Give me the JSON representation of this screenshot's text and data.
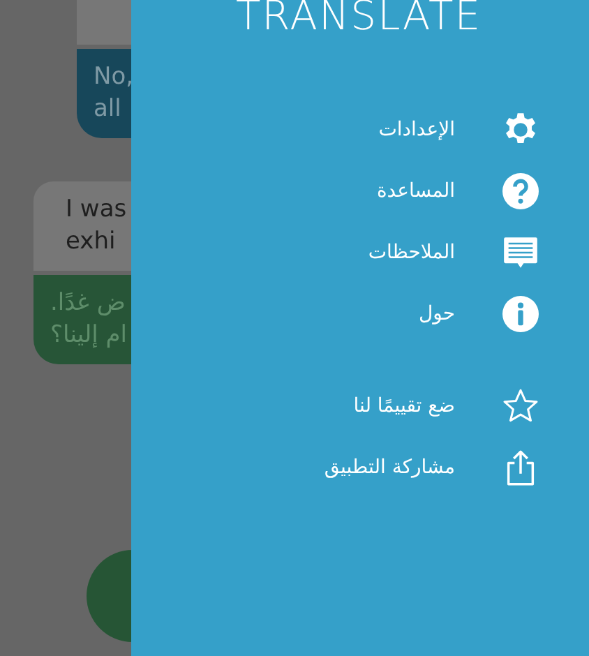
{
  "chat": {
    "messages": [
      {
        "kind": "original",
        "color": "#777777"
      },
      {
        "kind": "translation",
        "color": "#17475a",
        "lines": [
          "No,",
          "all"
        ]
      },
      {
        "kind": "original",
        "color": "#777777",
        "lines": [
          "I was",
          "exhi"
        ]
      },
      {
        "kind": "translation",
        "color": "#275537",
        "lines": [
          "ض غدًا.",
          "ام إلينا؟"
        ]
      }
    ]
  },
  "drawer": {
    "title": "TRANSLATE",
    "groups": [
      [
        {
          "kind": "settings",
          "label": "الإعدادات"
        },
        {
          "kind": "help",
          "label": "المساعدة"
        },
        {
          "kind": "feedback",
          "label": "الملاحظات"
        },
        {
          "kind": "about",
          "label": "حول"
        }
      ],
      [
        {
          "kind": "rate",
          "label": "ضع تقييمًا لنا"
        },
        {
          "kind": "share",
          "label": "مشاركة التطبيق"
        }
      ]
    ]
  }
}
